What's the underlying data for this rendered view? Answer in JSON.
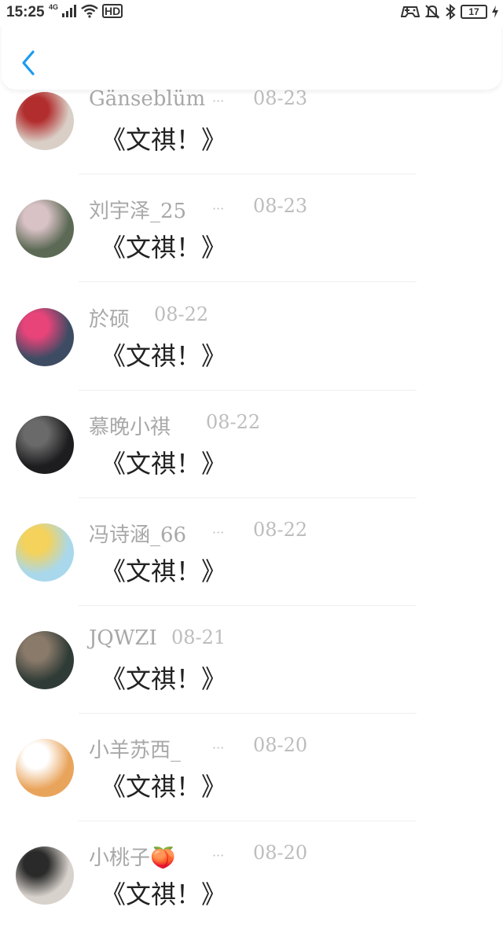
{
  "status_bar": {
    "time": "15:25",
    "network": "4G",
    "hd": "HD",
    "battery": "17"
  },
  "header": {
    "back_icon": "chevron-left-icon",
    "accent": "#1a9bf0"
  },
  "items": [
    {
      "name": "Gänseblüm",
      "truncated": "···",
      "date": "08-23",
      "message": "《文祺！》",
      "avatar_colors": [
        "#d9cfc6",
        "#b22d2d"
      ]
    },
    {
      "name": "刘宇泽_25",
      "truncated": "···",
      "date": "08-23",
      "message": "《文祺！》",
      "avatar_colors": [
        "#5c6a55",
        "#d9c2c6"
      ]
    },
    {
      "name": "於硕",
      "truncated": "",
      "date": "08-22",
      "message": "《文祺！》",
      "avatar_colors": [
        "#3d4c63",
        "#e8447a"
      ]
    },
    {
      "name": "慕晚小祺",
      "truncated": "",
      "date": "08-22",
      "message": "《文祺！》",
      "avatar_colors": [
        "#1d1d1f",
        "#6a6a6a"
      ]
    },
    {
      "name": "冯诗涵_66",
      "truncated": "···",
      "date": "08-22",
      "message": "《文祺！》",
      "avatar_colors": [
        "#a9d8ec",
        "#f4d25b"
      ]
    },
    {
      "name": "JQWZI",
      "truncated": "",
      "date": "08-21",
      "message": "《文祺！》",
      "avatar_colors": [
        "#2f3b36",
        "#8a7a6a"
      ]
    },
    {
      "name": "小羊苏西_",
      "truncated": "···",
      "date": "08-20",
      "message": "《文祺！》",
      "avatar_colors": [
        "#e9a45c",
        "#ffffff"
      ]
    },
    {
      "name": "小桃子🍑",
      "truncated": "···",
      "date": "08-20",
      "message": "《文祺！》",
      "avatar_colors": [
        "#d8d2cc",
        "#2a2a2a"
      ]
    }
  ]
}
